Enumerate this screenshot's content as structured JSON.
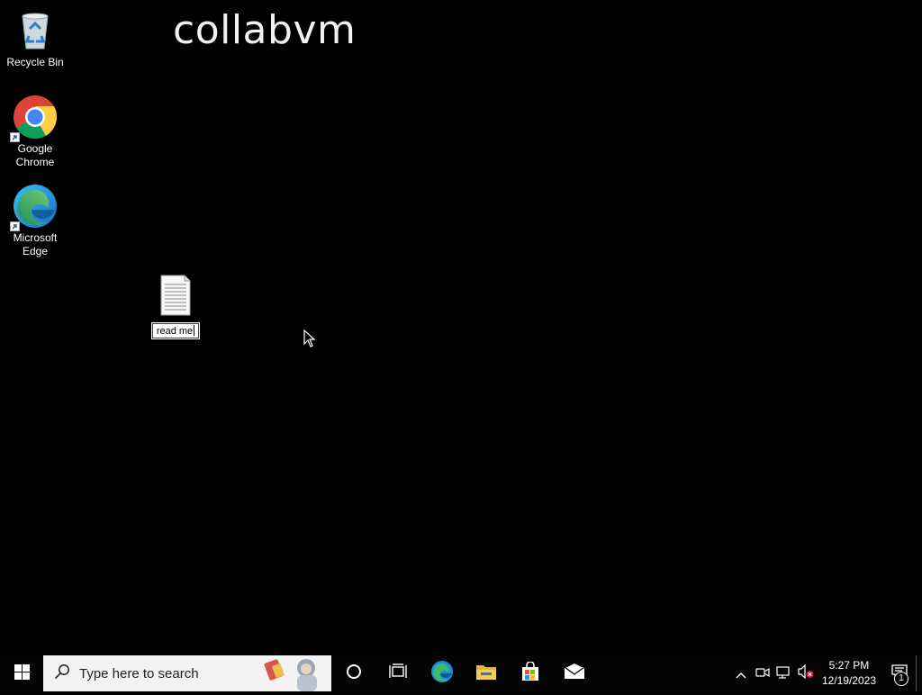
{
  "desktop": {
    "watermark": "collabvm",
    "icons": [
      {
        "label": "Recycle Bin",
        "icon": "recycle-bin-icon"
      },
      {
        "label": "Google\nChrome",
        "icon": "chrome-icon"
      },
      {
        "label": "Microsoft\nEdge",
        "icon": "edge-icon"
      },
      {
        "label": "read me",
        "icon": "text-file-icon",
        "renaming": true
      }
    ]
  },
  "taskbar": {
    "start_icon": "windows-start-icon",
    "search_placeholder": "Type here to search",
    "apps": [
      "cortana-icon",
      "task-view-icon",
      "edge-icon",
      "file-explorer-icon",
      "store-icon",
      "mail-icon"
    ],
    "tray_icons": [
      "chevron-up-icon",
      "meet-now-icon",
      "network-icon",
      "volume-muted-icon"
    ],
    "clock": {
      "time": "5:27 PM",
      "date": "12/19/2023"
    },
    "notification_count": "1",
    "colors": {
      "accent": "#0078d7",
      "taskbar": "#050505",
      "search_bg": "#f3f3f3"
    }
  }
}
